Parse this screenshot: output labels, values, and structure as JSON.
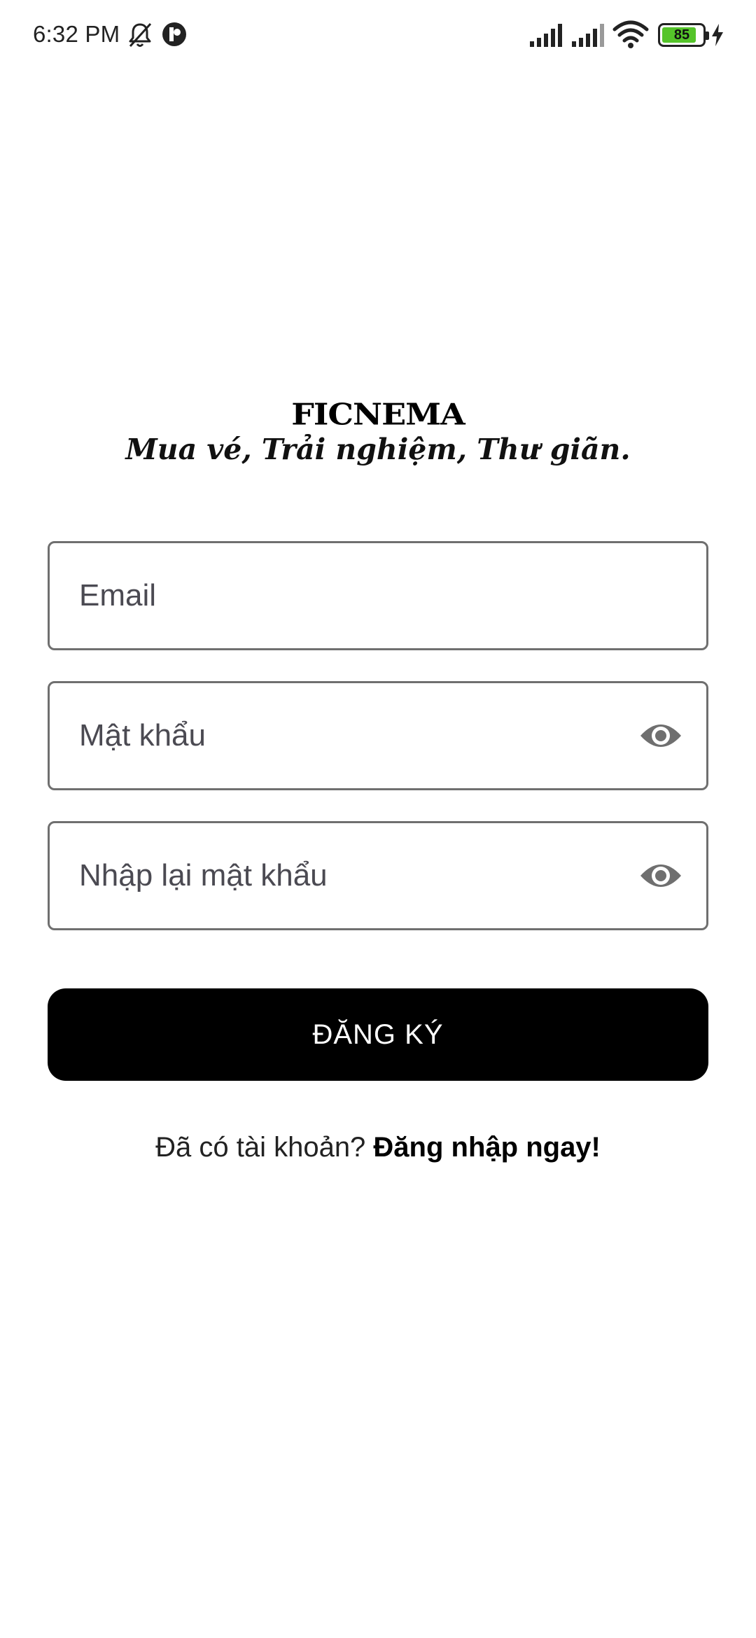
{
  "status_bar": {
    "time": "6:32 PM",
    "icons": [
      "bell-off-icon",
      "app-notification-icon",
      "signal-icon",
      "signal-icon",
      "wifi-icon",
      "battery-icon",
      "charging-icon"
    ],
    "battery_level": "85",
    "battery_fraction": 0.85,
    "battery_color": "#55c42a"
  },
  "brand": {
    "logo_text": "FICNEMA",
    "tagline": "Mua vé, Trải nghiệm, Thư giãn."
  },
  "form": {
    "email_placeholder": "Email",
    "email_value": "",
    "password_placeholder": "Mật khẩu",
    "password_value": "",
    "confirm_placeholder": "Nhập lại mật khẩu",
    "confirm_value": "",
    "submit_label": "ĐĂNG KÝ"
  },
  "footer": {
    "prompt": "Đã có tài khoản? ",
    "link": "Đăng nhập ngay!"
  },
  "colors": {
    "button_bg": "#000000",
    "field_border": "#6f6f6f",
    "eye_icon": "#6f6f6f"
  }
}
